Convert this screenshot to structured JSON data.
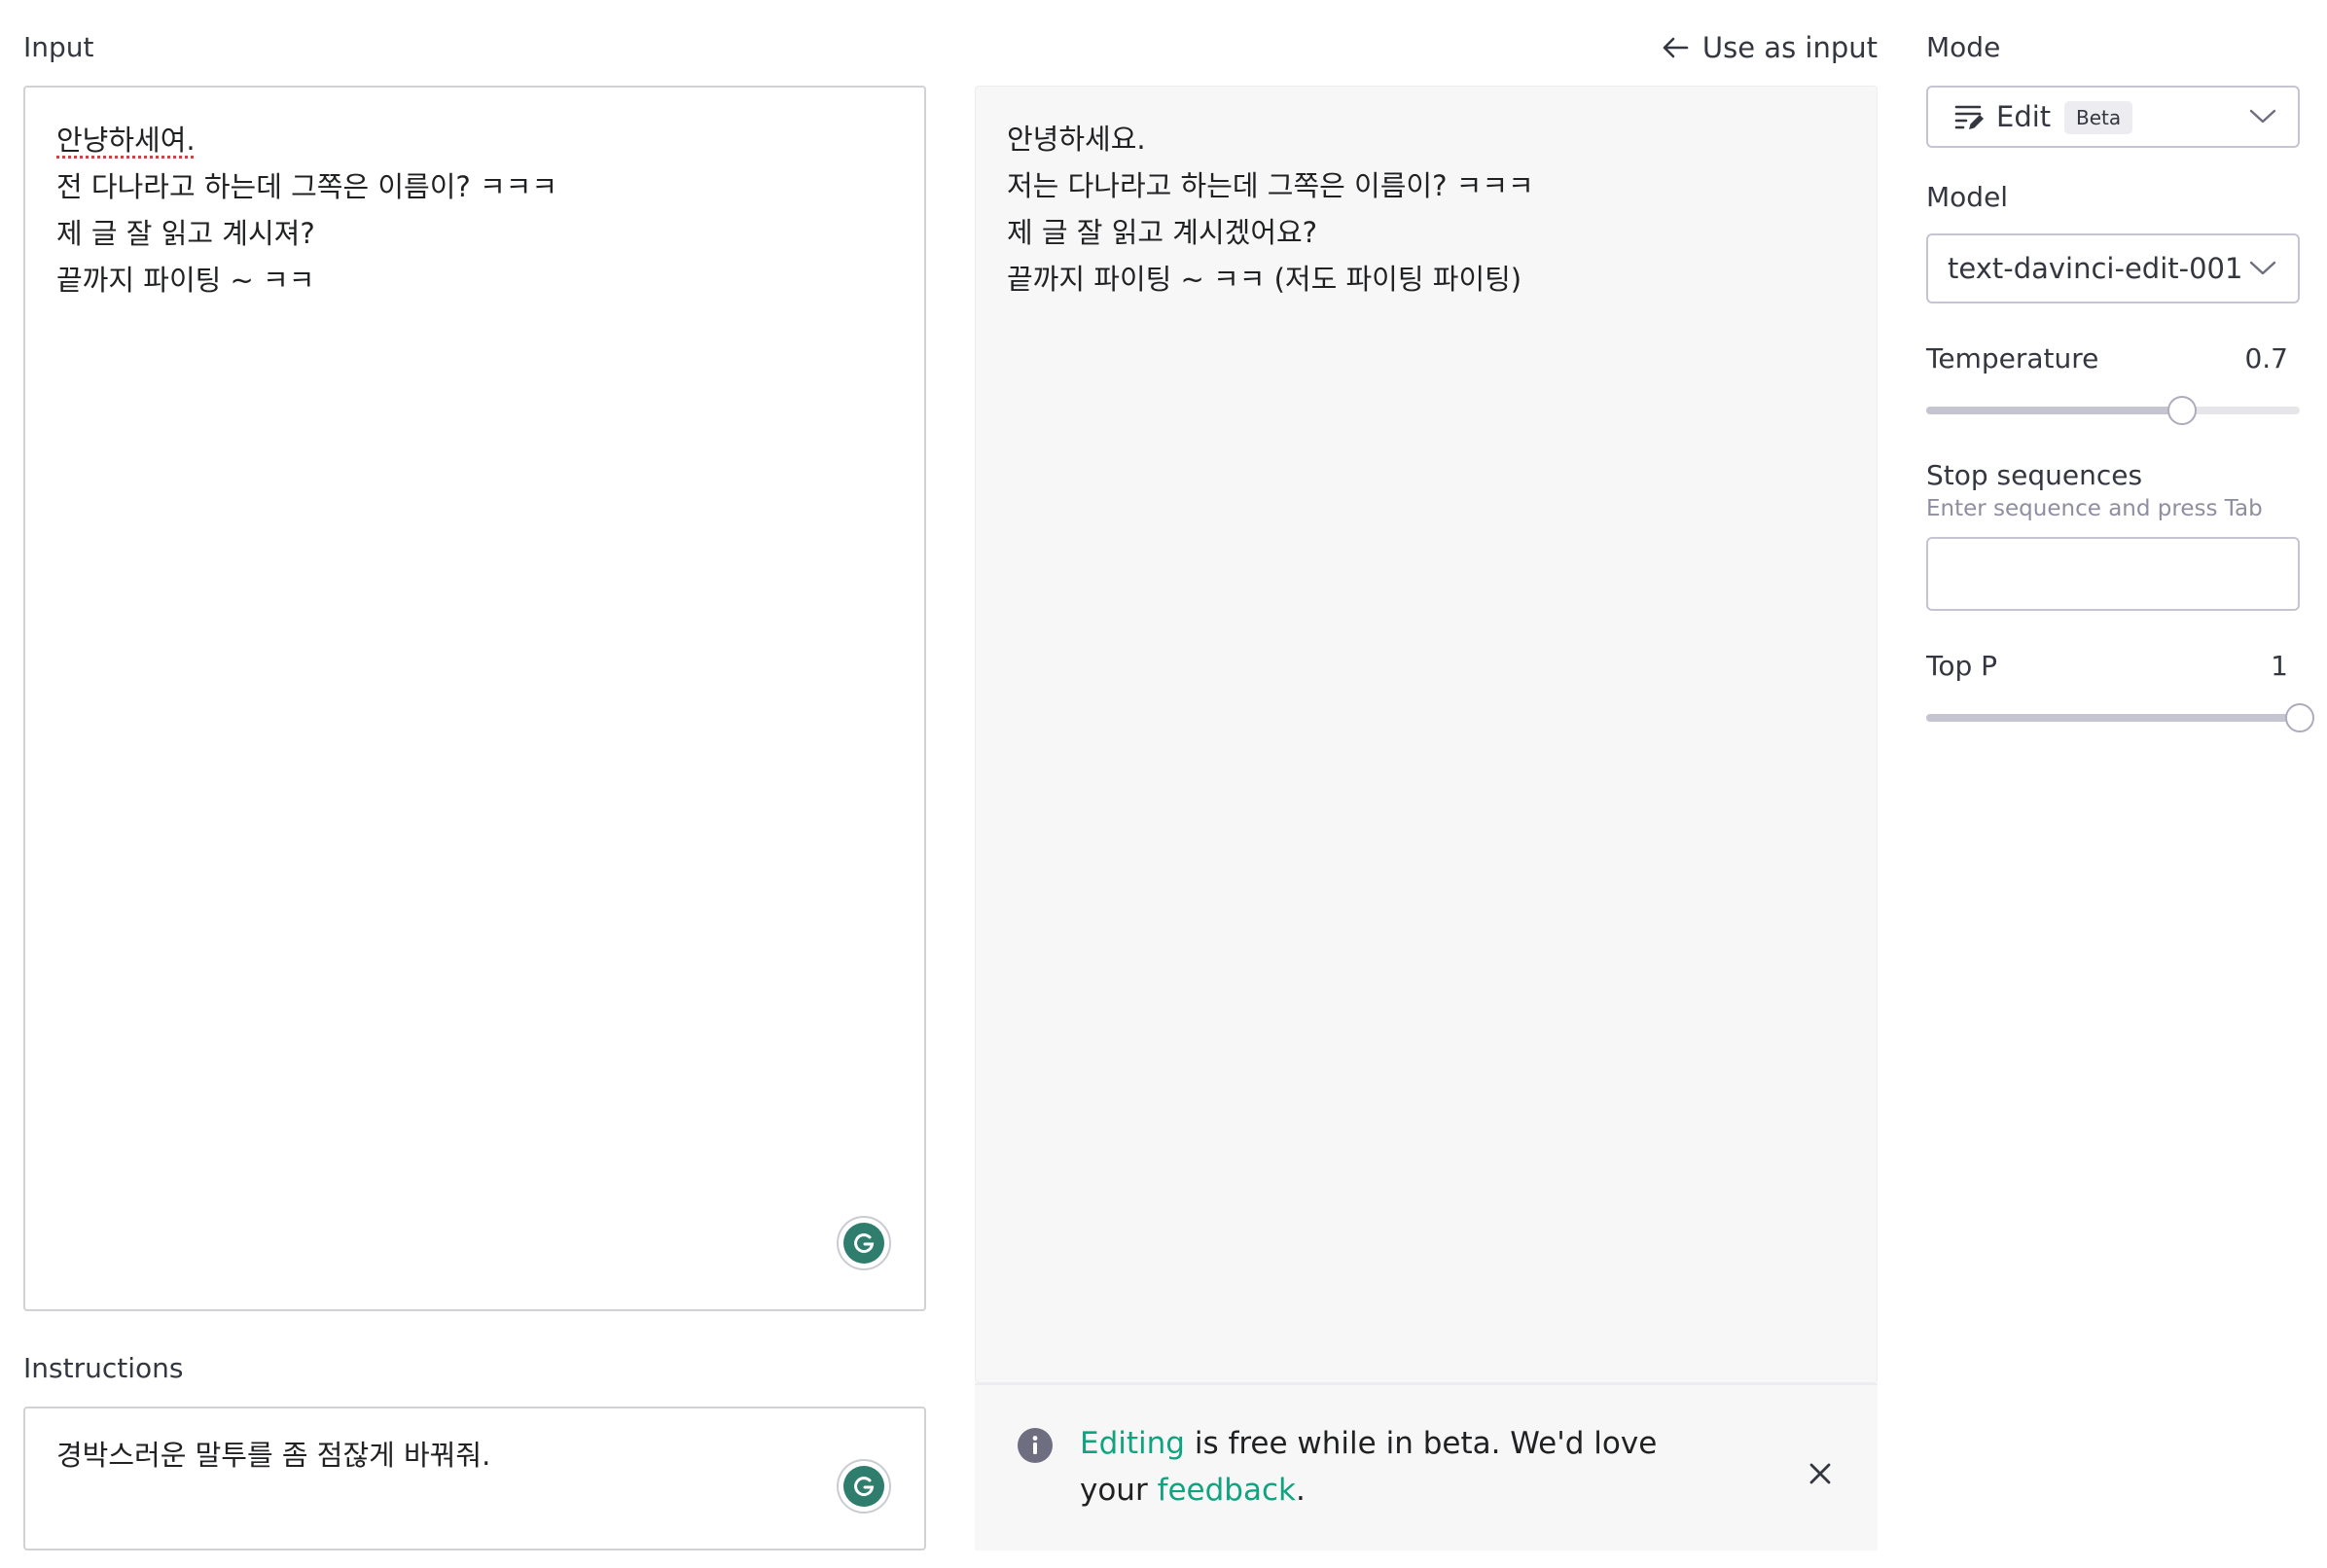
{
  "input": {
    "label": "Input",
    "lines": [
      "안냥하세여.",
      "전 다나라고 하는데 그쪽은 이름이? ㅋㅋㅋ",
      "제 글 잘 읽고 계시져?",
      "끝까지 파이팅 ~ ㅋㅋ"
    ]
  },
  "instructions": {
    "label": "Instructions",
    "text": "경박스러운 말투를 좀 점잖게 바꿔줘."
  },
  "output": {
    "use_as_input_label": "Use as input",
    "lines": [
      "안녕하세요.",
      "저는 다나라고 하는데 그쪽은 이름이? ㅋㅋㅋ",
      "제 글 잘 읽고 계시겠어요?",
      "끝까지 파이팅 ~ ㅋㅋ (저도 파이팅 파이팅)"
    ]
  },
  "banner": {
    "link1": "Editing",
    "text_mid": " is free while in beta. We'd love your ",
    "link2": "feedback",
    "text_end": "."
  },
  "settings": {
    "mode_label": "Mode",
    "mode_value": "Edit",
    "mode_badge": "Beta",
    "model_label": "Model",
    "model_value": "text-davinci-edit-001",
    "temperature_label": "Temperature",
    "temperature_value": "0.7",
    "temperature_fraction": 0.7,
    "stop_label": "Stop sequences",
    "stop_hint": "Enter sequence and press Tab",
    "stop_value": "",
    "top_p_label": "Top P",
    "top_p_value": "1",
    "top_p_fraction": 1.0
  },
  "icons": {
    "grammarly": "grammarly-icon",
    "edit_mode": "edit-mode-icon",
    "arrow_left": "arrow-left-icon",
    "info": "info-icon",
    "close": "close-icon",
    "chevron": "chevron-down-icon"
  },
  "colors": {
    "accent_green": "#10a37f",
    "grammarly_green": "#2f7d6d"
  }
}
